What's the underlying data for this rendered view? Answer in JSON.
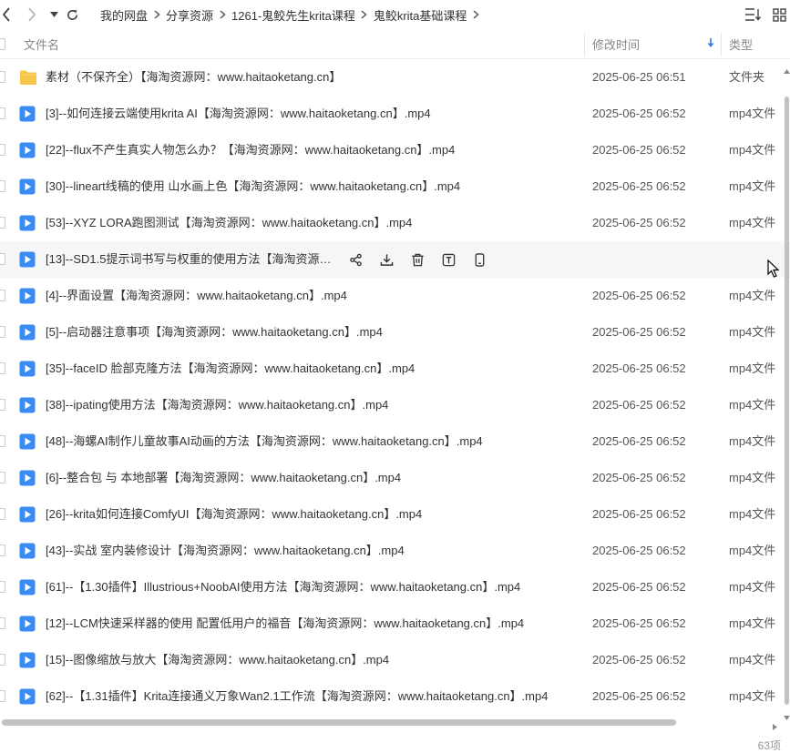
{
  "breadcrumbs": [
    "我的网盘",
    "分享资源",
    "1261-鬼鲛先生krita课程",
    "鬼鲛krita基础课程"
  ],
  "columns": {
    "name": "文件名",
    "time": "修改时间",
    "type": "类型"
  },
  "rows": [
    {
      "name": "素材（不保齐全）【海淘资源网：www.haitaoketang.cn】",
      "time": "2025-06-25 06:51",
      "type": "文件夹",
      "kind": "folder"
    },
    {
      "name": "[3]--如何连接云端使用krita AI【海淘资源网：www.haitaoketang.cn】.mp4",
      "time": "2025-06-25 06:52",
      "type": "mp4文件",
      "kind": "video"
    },
    {
      "name": "[22]--flux不产生真实人物怎么办？【海淘资源网：www.haitaoketang.cn】.mp4",
      "time": "2025-06-25 06:52",
      "type": "mp4文件",
      "kind": "video"
    },
    {
      "name": "[30]--lineart线稿的使用 山水画上色【海淘资源网：www.haitaoketang.cn】.mp4",
      "time": "2025-06-25 06:52",
      "type": "mp4文件",
      "kind": "video"
    },
    {
      "name": "[53]--XYZ LORA跑图测试【海淘资源网：www.haitaoketang.cn】.mp4",
      "time": "2025-06-25 06:52",
      "type": "mp4文件",
      "kind": "video"
    },
    {
      "name": "[13]--SD1.5提示词书写与权重的使用方法【海淘资源网：...",
      "time": "",
      "type": "",
      "kind": "video",
      "hover": true
    },
    {
      "name": "[4]--界面设置【海淘资源网：www.haitaoketang.cn】.mp4",
      "time": "2025-06-25 06:52",
      "type": "mp4文件",
      "kind": "video"
    },
    {
      "name": "[5]--启动器注意事项【海淘资源网：www.haitaoketang.cn】.mp4",
      "time": "2025-06-25 06:52",
      "type": "mp4文件",
      "kind": "video"
    },
    {
      "name": "[35]--faceID 脸部克隆方法【海淘资源网：www.haitaoketang.cn】.mp4",
      "time": "2025-06-25 06:52",
      "type": "mp4文件",
      "kind": "video"
    },
    {
      "name": "[38]--ipating使用方法【海淘资源网：www.haitaoketang.cn】.mp4",
      "time": "2025-06-25 06:52",
      "type": "mp4文件",
      "kind": "video"
    },
    {
      "name": "[48]--海螺AI制作儿童故事AI动画的方法【海淘资源网：www.haitaoketang.cn】.mp4",
      "time": "2025-06-25 06:52",
      "type": "mp4文件",
      "kind": "video"
    },
    {
      "name": "[6]--整合包 与 本地部署【海淘资源网：www.haitaoketang.cn】.mp4",
      "time": "2025-06-25 06:52",
      "type": "mp4文件",
      "kind": "video"
    },
    {
      "name": "[26]--krita如何连接ComfyUI【海淘资源网：www.haitaoketang.cn】.mp4",
      "time": "2025-06-25 06:52",
      "type": "mp4文件",
      "kind": "video"
    },
    {
      "name": "[43]--实战 室内装修设计【海淘资源网：www.haitaoketang.cn】.mp4",
      "time": "2025-06-25 06:52",
      "type": "mp4文件",
      "kind": "video"
    },
    {
      "name": "[61]--【1.30插件】Illustrious+NoobAI使用方法【海淘资源网：www.haitaoketang.cn】.mp4",
      "time": "2025-06-25 06:52",
      "type": "mp4文件",
      "kind": "video"
    },
    {
      "name": "[12]--LCM快速采样器的使用 配置低用户的福音【海淘资源网：www.haitaoketang.cn】.mp4",
      "time": "2025-06-25 06:52",
      "type": "mp4文件",
      "kind": "video"
    },
    {
      "name": "[15]--图像缩放与放大【海淘资源网：www.haitaoketang.cn】.mp4",
      "time": "2025-06-25 06:52",
      "type": "mp4文件",
      "kind": "video"
    },
    {
      "name": "[62]--【1.31插件】Krita连接通义万象Wan2.1工作流【海淘资源网：www.haitaoketang.cn】.mp4",
      "time": "2025-06-25 06:52",
      "type": "mp4文件",
      "kind": "video"
    }
  ],
  "row_actions": [
    "share-icon",
    "download-icon",
    "delete-icon",
    "rename-icon",
    "phone-icon"
  ],
  "footer": {
    "count": "63项"
  },
  "colors": {
    "folder": "#f8c64a",
    "video": "#3b8bf5",
    "accent": "#2e7cf6"
  }
}
